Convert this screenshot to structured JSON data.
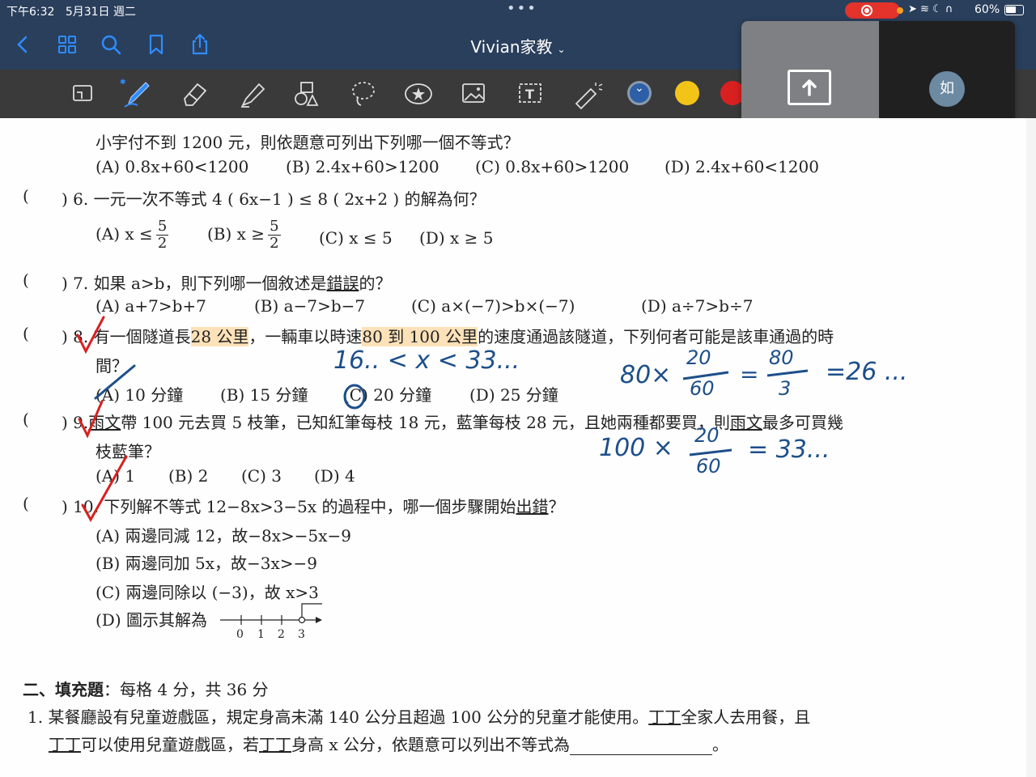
{
  "status_bar": {
    "time": "下午6:32",
    "date": "5月31日 週二",
    "battery": "60%"
  },
  "nav": {
    "title": "Vivian家教",
    "title_chevron": "⌄"
  },
  "video_panel": {
    "avatar_text": "如",
    "user_name": "如"
  },
  "colors": {
    "accent": "#2a3f5c",
    "pen_blue": "#2d5ea8",
    "pen_yellow": "#f2c418",
    "pen_red": "#d92020",
    "highlight": "#fde1b8"
  },
  "document": {
    "q5_line": "小宇付不到 1200 元，則依題意可列出下列哪一個不等式？",
    "q5_options": [
      "(A) 0.8x+60<1200",
      "(B) 2.4x+60>1200",
      "(C) 0.8x+60>1200",
      "(D) 2.4x+60<1200"
    ],
    "q6_paren": "(",
    "q6": ") 6. 一元一次不等式 4 ( 6x−1 ) ≤ 8 ( 2x+2 ) 的解為何？",
    "q6_options": {
      "a_pre": "(A) x ≤",
      "b_pre": "(B) x ≥",
      "frac_num": "5",
      "frac_den": "2",
      "c": "(C) x ≤ 5",
      "d": "(D) x ≥ 5"
    },
    "q7_paren": "(",
    "q7_pre": ") 7. 如果 a>b，則下列哪一個敘述是",
    "q7_under": "錯誤",
    "q7_post": "的？",
    "q7_options": [
      "(A) a+7>b+7",
      "(B) a−7>b−7",
      "(C) a×(−7)>b×(−7)",
      "(D) a÷7>b÷7"
    ],
    "q8_paren": "(",
    "q8_pre": ") 8. 有一個隧道長",
    "q8_hl1": "28 公里",
    "q8_mid": "，一輛車以時速",
    "q8_hl2": "80 到 100 公里",
    "q8_post": "的速度通過該隧道，下列何者可能是該車通過的時",
    "q8_line2": "間？",
    "q8_options": [
      "(A) 10 分鐘",
      "(B) 15 分鐘",
      "(C) 20 分鐘",
      "(D) 25 分鐘"
    ],
    "q9_paren": "(",
    "q9_pre": ") 9.",
    "q9_name": "雨文",
    "q9_mid": "帶 100 元去買 5 枝筆，已知紅筆每枝 18 元，藍筆每枝 28 元，且她兩種都要買，則",
    "q9_name2": "雨文",
    "q9_post": "最多可買幾",
    "q9_line2": "枝藍筆？",
    "q9_options": [
      "(A) 1",
      "(B) 2",
      "(C) 3",
      "(D) 4"
    ],
    "q10_paren": "(",
    "q10_pre": ") 10. 下列解不等式 12−8x>3−5x 的過程中，哪一個步驟開始",
    "q10_under": "出錯",
    "q10_post": "？",
    "q10_options": [
      "(A) 兩邊同減 12，故−8x>−5x−9",
      "(B) 兩邊同加 5x，故−3x>−9",
      "(C) 兩邊同除以 (−3)，故 x>3",
      "(D) 圖示其解為"
    ],
    "number_line_ticks": [
      "0",
      "1",
      "2",
      "3"
    ],
    "section2_bold": "二、填充題",
    "section2_rest": "：每格 4 分，共 36 分",
    "fill1_pre": "1. 某餐廳設有兒童遊戲區，規定身高未滿 140 公分且超過 100 公分的兒童才能使用。",
    "fill1_name": "丁丁",
    "fill1_post": "全家人去用餐，且",
    "fill1_line2_name": "丁丁",
    "fill1_line2_mid": "可以使用兒童遊戲區，若",
    "fill1_line2_name2": "丁丁",
    "fill1_line2_post": "身高 x 公分，依題意可以列出不等式為",
    "fill1_end": "。"
  },
  "handwriting": {
    "ineq": "16.. < x < 33...",
    "eq1_lhs": "80×",
    "eq1_frac_num": "20",
    "eq1_frac_den": "60",
    "eq1_mid": "=",
    "eq1_frac2_num": "80",
    "eq1_frac2_den": "3",
    "eq1_rhs": "=26 ...",
    "eq2_lhs": "100 ×",
    "eq2_frac_num": "20",
    "eq2_frac_den": "60",
    "eq2_rhs": "= 33...",
    "circled_option": "0"
  }
}
